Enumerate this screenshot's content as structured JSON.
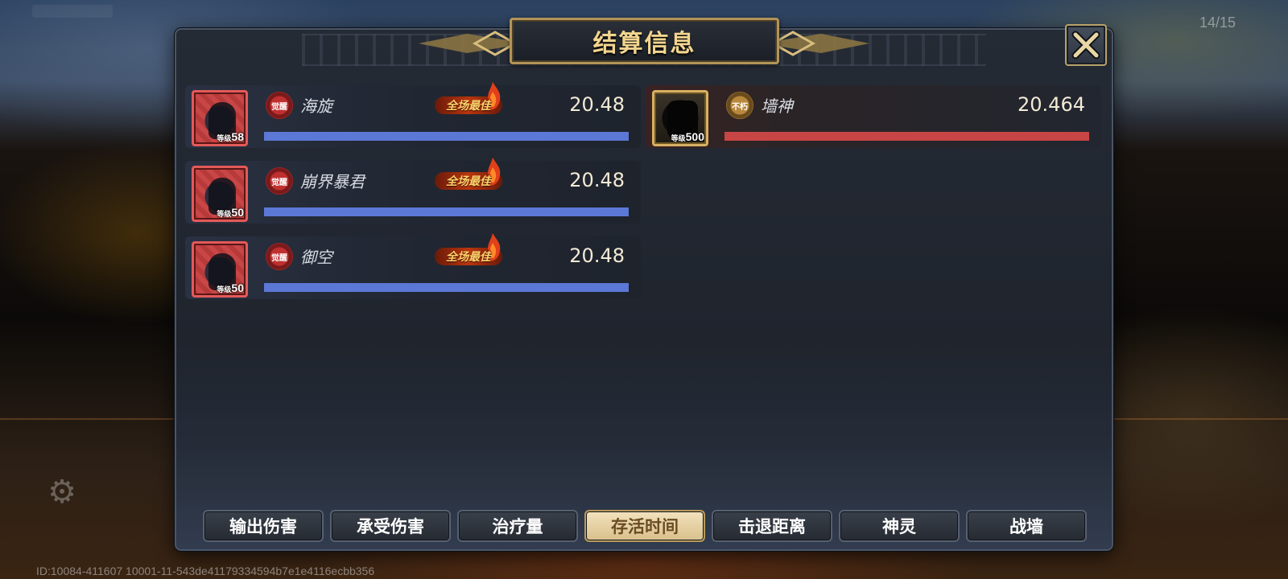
{
  "background": {
    "top_right_counter": "14/15"
  },
  "dialog": {
    "title": "结算信息",
    "close_icon": "close-x-icon"
  },
  "rows_left": [
    {
      "name": "海旋",
      "level_prefix": "等级",
      "level": "58",
      "badge": "觉醒",
      "best_tag": "全场最佳",
      "value": "20.48",
      "bar_fraction": 1.0,
      "portrait_icon": "hero-portrait-icon"
    },
    {
      "name": "崩界暴君",
      "level_prefix": "等级",
      "level": "50",
      "badge": "觉醒",
      "best_tag": "全场最佳",
      "value": "20.48",
      "bar_fraction": 1.0,
      "portrait_icon": "hero-portrait-icon"
    },
    {
      "name": "御空",
      "level_prefix": "等级",
      "level": "50",
      "badge": "觉醒",
      "best_tag": "全场最佳",
      "value": "20.48",
      "bar_fraction": 1.0,
      "portrait_icon": "hero-portrait-icon"
    }
  ],
  "rows_right": [
    {
      "name": "墙神",
      "level_prefix": "等级",
      "level": "500",
      "badge": "不朽",
      "value": "20.464",
      "bar_fraction": 1.0,
      "portrait_icon": "wall-god-portrait-icon"
    }
  ],
  "tabs": [
    {
      "label": "输出伤害",
      "active": false
    },
    {
      "label": "承受伤害",
      "active": false
    },
    {
      "label": "治疗量",
      "active": false
    },
    {
      "label": "存活时间",
      "active": true
    },
    {
      "label": "击退距离",
      "active": false
    },
    {
      "label": "神灵",
      "active": false
    },
    {
      "label": "战墙",
      "active": false
    }
  ],
  "footer": {
    "id_text": "ID:10084-411607 10001-11-543de41179334594b7e1e4116ecbb356"
  },
  "colors": {
    "title_gold": "#f3d58e",
    "ally_bar": "#5c78d6",
    "enemy_bar": "#c84545",
    "active_tab": "#e8d3a4"
  }
}
